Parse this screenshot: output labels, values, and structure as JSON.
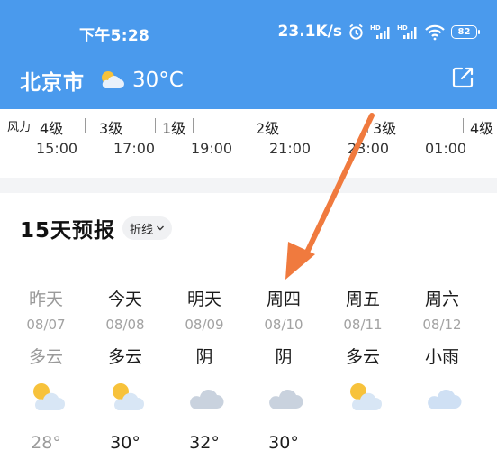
{
  "status_bar": {
    "time": "下午5:28",
    "network_speed": "23.1K/s",
    "battery": "82",
    "icons": [
      "alarm-icon",
      "hd-signal-icon",
      "hd-signal-icon",
      "wifi-icon",
      "battery-icon"
    ]
  },
  "header": {
    "city": "北京市",
    "weather_icon": "partly-cloudy-icon",
    "temperature": "30°C",
    "share_icon": "share-icon"
  },
  "hourly": {
    "wind_label": "风力",
    "wind_levels": [
      "4级",
      "3级",
      "1级",
      "2级",
      "3级",
      "4级"
    ],
    "hours": [
      "15:00",
      "17:00",
      "19:00",
      "21:00",
      "23:00",
      "01:00"
    ]
  },
  "forecast": {
    "title": "15天预报",
    "view_toggle": "折线",
    "days": [
      {
        "name": "昨天",
        "date": "08/07",
        "condition": "多云",
        "icon": "partly-cloudy-icon",
        "temp": "28°",
        "past": true
      },
      {
        "name": "今天",
        "date": "08/08",
        "condition": "多云",
        "icon": "partly-cloudy-icon",
        "temp": "30°",
        "past": false
      },
      {
        "name": "明天",
        "date": "08/09",
        "condition": "阴",
        "icon": "overcast-icon",
        "temp": "32°",
        "past": false
      },
      {
        "name": "周四",
        "date": "08/10",
        "condition": "阴",
        "icon": "overcast-icon",
        "temp": "30°",
        "past": false
      },
      {
        "name": "周五",
        "date": "08/11",
        "condition": "多云",
        "icon": "partly-cloudy-icon",
        "temp": "",
        "past": false
      },
      {
        "name": "周六",
        "date": "08/12",
        "condition": "小雨",
        "icon": "light-rain-icon",
        "temp": "",
        "past": false
      }
    ]
  },
  "colors": {
    "header_blue": "#4a9aed",
    "annotation_arrow": "#f07a3e",
    "sun": "#f7c23b",
    "cloud": "#d8e6f5"
  }
}
